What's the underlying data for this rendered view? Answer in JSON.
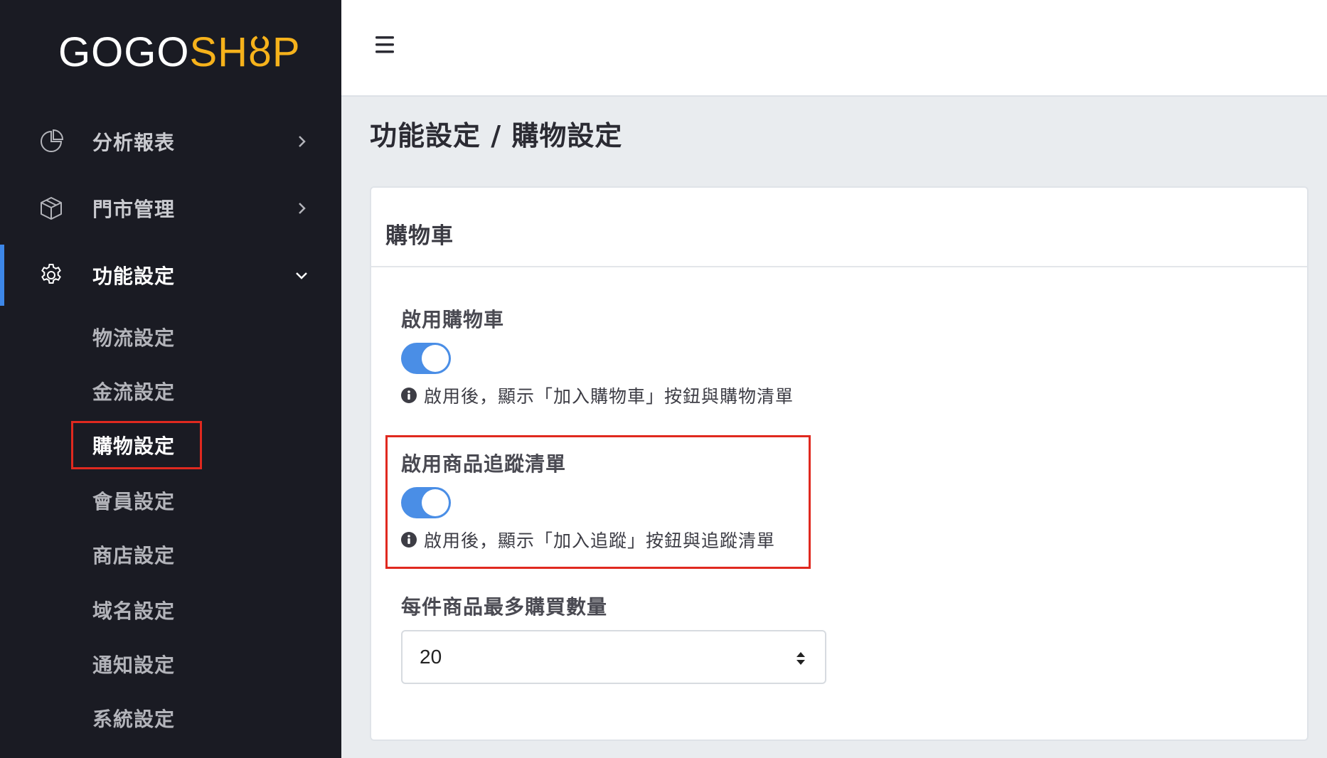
{
  "logo": {
    "part1": "GOGO",
    "part2": "SH",
    "part3": "ȣ",
    "part4": "P"
  },
  "sidebar": {
    "items": [
      {
        "label": "分析報表",
        "icon": "pie-chart-icon"
      },
      {
        "label": "門市管理",
        "icon": "box-icon"
      },
      {
        "label": "功能設定",
        "icon": "gear-icon"
      }
    ],
    "sub_items": [
      {
        "label": "物流設定"
      },
      {
        "label": "金流設定"
      },
      {
        "label": "購物設定"
      },
      {
        "label": "會員設定"
      },
      {
        "label": "商店設定"
      },
      {
        "label": "域名設定"
      },
      {
        "label": "通知設定"
      },
      {
        "label": "系統設定"
      }
    ]
  },
  "page": {
    "title": "功能設定 / 購物設定"
  },
  "card": {
    "title": "購物車",
    "cart_toggle": {
      "label": "啟用購物車",
      "help": "啟用後，顯示「加入購物車」按鈕與購物清單"
    },
    "wishlist_toggle": {
      "label": "啟用商品追蹤清單",
      "help": "啟用後，顯示「加入追蹤」按鈕與追蹤清單"
    },
    "max_qty": {
      "label": "每件商品最多購買數量",
      "value": "20"
    }
  },
  "colors": {
    "accent": "#4a8ee6",
    "highlight": "#e0291f",
    "logo_yellow": "#f6b21b",
    "sidebar_bg": "#1a1b23"
  }
}
